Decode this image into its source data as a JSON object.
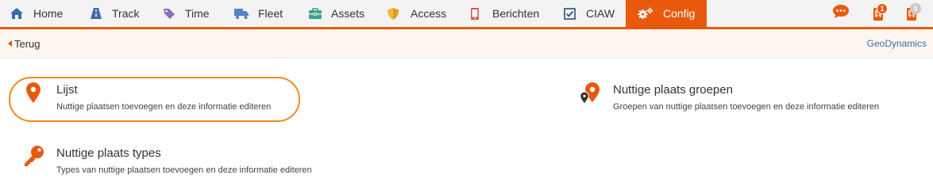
{
  "nav": {
    "items": [
      {
        "label": "Home",
        "icon": "home-icon"
      },
      {
        "label": "Track",
        "icon": "road-icon"
      },
      {
        "label": "Time",
        "icon": "tag-icon"
      },
      {
        "label": "Fleet",
        "icon": "truck-icon"
      },
      {
        "label": "Assets",
        "icon": "toolbox-icon"
      },
      {
        "label": "Access",
        "icon": "shield-icon"
      },
      {
        "label": "Berichten",
        "icon": "mobile-icon"
      },
      {
        "label": "CIAW",
        "icon": "checkbox-icon"
      },
      {
        "label": "Config",
        "icon": "cogs-icon",
        "active": true
      }
    ]
  },
  "header_icons": {
    "chat": {
      "icon": "chat-icon"
    },
    "alerts_orange": {
      "icon": "alert-device-icon",
      "count": "1"
    },
    "alerts_grey": {
      "icon": "alert-device-icon",
      "count": "0"
    }
  },
  "subbar": {
    "back_label": "Terug",
    "company": "GeoDynamics"
  },
  "cards": {
    "lijst": {
      "title": "Lijst",
      "desc": "Nuttige plaatsen toevoegen en deze informatie editeren",
      "icon": "map-marker-icon"
    },
    "groepen": {
      "title": "Nuttige plaats groepen",
      "desc": "Groepen van nuttige plaatsen toevoegen en deze informatie editeren",
      "icon": "map-markers-icon"
    },
    "types": {
      "title": "Nuttige plaats types",
      "desc": "Types van nuttige plaatsen toevoegen en deze informatie editeren",
      "icon": "key-icon"
    }
  },
  "colors": {
    "accent": "#e8590c",
    "link": "#3a6ea5",
    "highlight": "#f28a1c"
  }
}
